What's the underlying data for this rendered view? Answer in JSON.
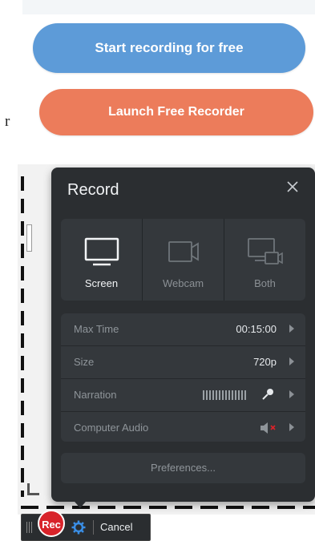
{
  "buttons": {
    "start_label": "Start recording for free",
    "launch_label": "Launch Free Recorder"
  },
  "stray_text": "r",
  "panel": {
    "title": "Record",
    "close_icon": "close-icon",
    "modes": [
      {
        "label": "Screen",
        "icon": "monitor-icon",
        "active": true
      },
      {
        "label": "Webcam",
        "icon": "webcam-icon",
        "active": false
      },
      {
        "label": "Both",
        "icon": "screen-webcam-icon",
        "active": false
      }
    ],
    "settings": [
      {
        "label": "Max Time",
        "value": "00:15:00"
      },
      {
        "label": "Size",
        "value": "720p"
      },
      {
        "label": "Narration",
        "value": ""
      },
      {
        "label": "Computer Audio",
        "value": ""
      }
    ],
    "preferences_label": "Preferences..."
  },
  "toolbar": {
    "rec_label": "Rec",
    "cancel_label": "Cancel"
  },
  "colors": {
    "start_button": "#5d9bd8",
    "launch_button": "#ec7c5b",
    "panel_bg": "#2b2e31",
    "rec_red": "#d8232a",
    "gear_blue": "#3a8ee6"
  }
}
